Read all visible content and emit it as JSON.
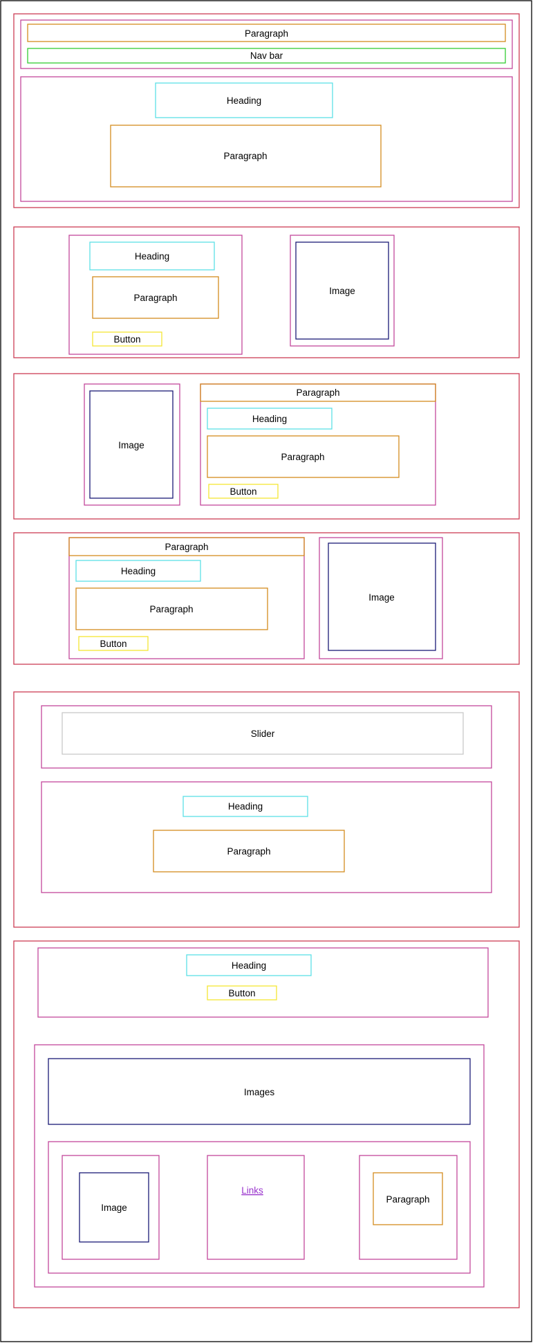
{
  "colors": {
    "frame": "#000000",
    "section": "#cc3d55",
    "container": "#c2479b",
    "paragraph": "#d48c1e",
    "navbar": "#33cc33",
    "heading": "#5ce0e6",
    "button": "#f5e633",
    "image": "#1a1a75",
    "slider": "#c8c8c8",
    "link": "#9933cc"
  },
  "labels": {
    "paragraph": "Paragraph",
    "nav_bar": "Nav bar",
    "heading": "Heading",
    "image": "Image",
    "button": "Button",
    "slider": "Slider",
    "images": "Images",
    "links": "Links"
  }
}
